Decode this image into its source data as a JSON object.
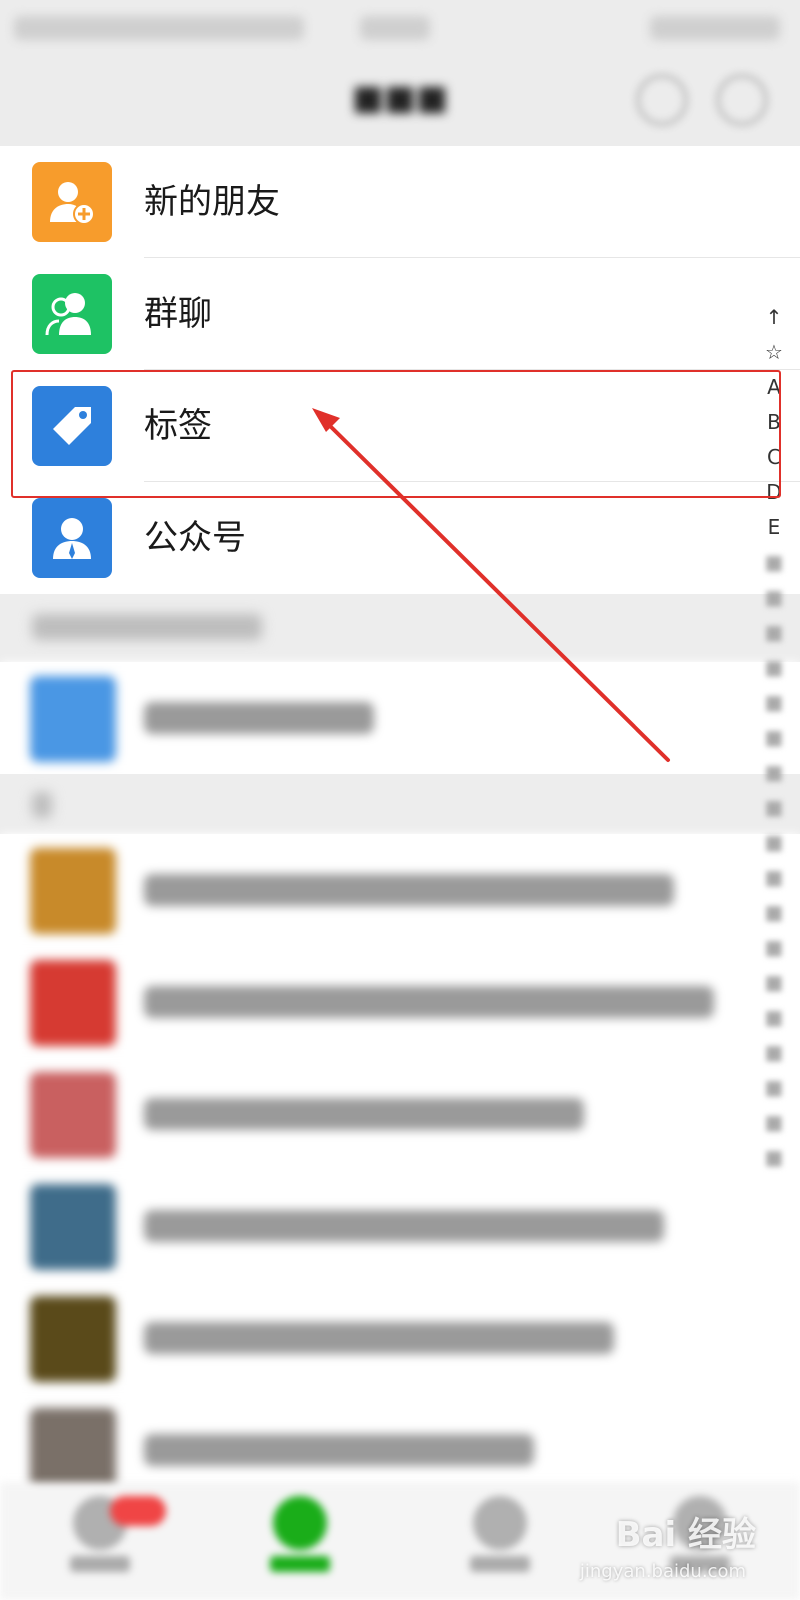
{
  "contacts": {
    "items": [
      {
        "label": "新的朋友",
        "icon": "add-friend-icon",
        "color": "#f79c2c"
      },
      {
        "label": "群聊",
        "icon": "group-chat-icon",
        "color": "#1ec264"
      },
      {
        "label": "标签",
        "icon": "tag-icon",
        "color": "#2e80dc"
      },
      {
        "label": "公众号",
        "icon": "official-account-icon",
        "color": "#2e80dc"
      }
    ]
  },
  "index_bar": {
    "letters": [
      "↑",
      "☆",
      "A",
      "B",
      "C",
      "D",
      "E"
    ]
  },
  "watermark": {
    "text": "Bai 经验",
    "url": "jingyan.baidu.com"
  },
  "annotation_color": "#e0302a"
}
